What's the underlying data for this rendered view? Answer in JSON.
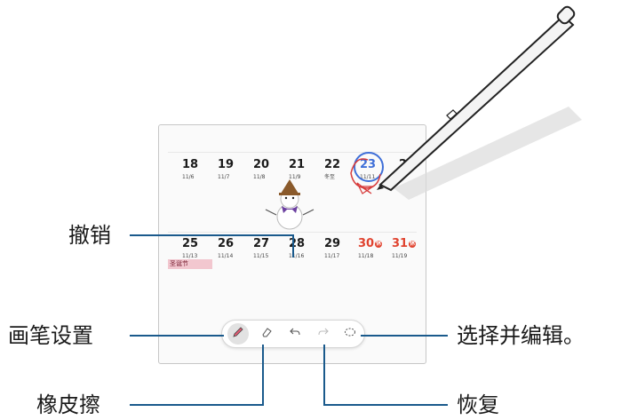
{
  "calendar": {
    "week1": [
      {
        "num": "18",
        "lunar": "11/6"
      },
      {
        "num": "19",
        "lunar": "11/7"
      },
      {
        "num": "20",
        "lunar": "11/8"
      },
      {
        "num": "21",
        "lunar": "11/9"
      },
      {
        "num": "22",
        "lunar": "冬至"
      },
      {
        "num": "23",
        "lunar": "11/11"
      },
      {
        "num": "2",
        "lunar": ""
      }
    ],
    "week2": [
      {
        "num": "25",
        "lunar": "11/13"
      },
      {
        "num": "26",
        "lunar": "11/14"
      },
      {
        "num": "27",
        "lunar": "11/15"
      },
      {
        "num": "28",
        "lunar": "11/16"
      },
      {
        "num": "29",
        "lunar": "11/17"
      },
      {
        "num": "30",
        "lunar": "11/18",
        "badge": "休"
      },
      {
        "num": "31",
        "lunar": "11/19",
        "badge": "休"
      }
    ],
    "event": "圣诞节",
    "today_color": "#3f6fd8",
    "holiday_color": "#e0432f"
  },
  "toolbar": {
    "pen_settings": "pen-icon",
    "eraser": "eraser-icon",
    "undo": "undo-icon",
    "redo": "redo-icon",
    "selection": "lasso-icon"
  },
  "callouts": {
    "undo": "撤销",
    "pen_settings": "画笔设置",
    "eraser": "橡皮擦",
    "select_edit": "选择并编辑。",
    "redo": "恢复"
  }
}
